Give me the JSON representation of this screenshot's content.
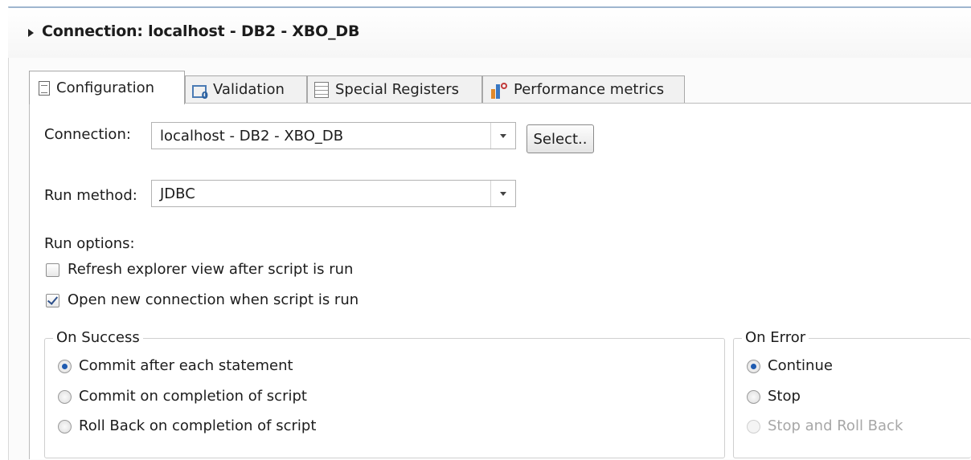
{
  "connection_header": {
    "title": "Connection: localhost - DB2 - XBO_DB"
  },
  "tabs": [
    {
      "label": "Configuration",
      "icon": "document-icon",
      "active": true
    },
    {
      "label": "Validation",
      "icon": "validation-icon",
      "active": false
    },
    {
      "label": "Special Registers",
      "icon": "list-icon",
      "active": false
    },
    {
      "label": "Performance metrics",
      "icon": "chart-icon",
      "active": false
    }
  ],
  "form": {
    "connection_label": "Connection:",
    "connection_value": "localhost - DB2 - XBO_DB",
    "select_button": "Select..",
    "run_method_label": "Run method:",
    "run_method_value": "JDBC",
    "run_options_label": "Run options:",
    "options": [
      {
        "label": "Refresh explorer view after script is run",
        "checked": false
      },
      {
        "label": "Open new connection when script is run",
        "checked": true
      }
    ]
  },
  "on_success": {
    "legend": "On Success",
    "options": [
      {
        "label": "Commit after each statement",
        "selected": true
      },
      {
        "label": "Commit on completion of script",
        "selected": false
      },
      {
        "label": "Roll Back on completion of script",
        "selected": false
      }
    ]
  },
  "on_error": {
    "legend": "On Error",
    "options": [
      {
        "label": "Continue",
        "selected": true,
        "enabled": true
      },
      {
        "label": "Stop",
        "selected": false,
        "enabled": true
      },
      {
        "label": "Stop and Roll Back",
        "selected": false,
        "enabled": false
      }
    ]
  },
  "colors": {
    "accent_blue": "#1f5bb0",
    "header_border": "#9fb6cf",
    "disabled_text": "#a7a7a7"
  }
}
